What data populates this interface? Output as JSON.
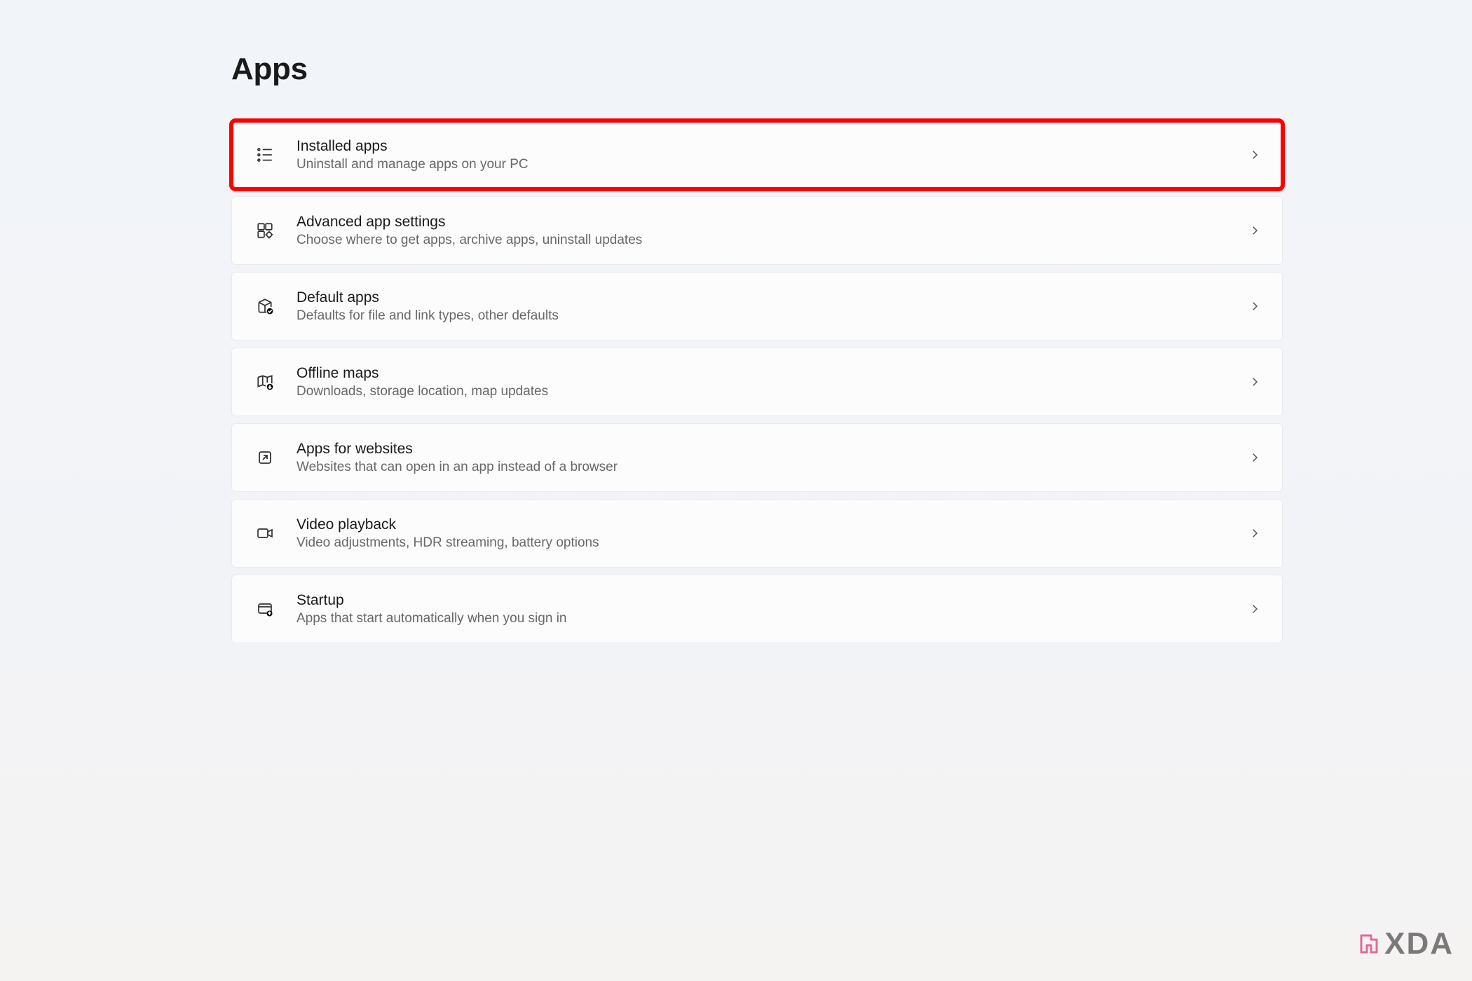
{
  "page": {
    "title": "Apps"
  },
  "items": [
    {
      "id": "installed-apps",
      "title": "Installed apps",
      "description": "Uninstall and manage apps on your PC",
      "icon": "list-checklist-icon",
      "highlighted": true
    },
    {
      "id": "advanced-app-settings",
      "title": "Advanced app settings",
      "description": "Choose where to get apps, archive apps, uninstall updates",
      "icon": "apps-gear-icon",
      "highlighted": false
    },
    {
      "id": "default-apps",
      "title": "Default apps",
      "description": "Defaults for file and link types, other defaults",
      "icon": "box-check-icon",
      "highlighted": false
    },
    {
      "id": "offline-maps",
      "title": "Offline maps",
      "description": "Downloads, storage location, map updates",
      "icon": "map-download-icon",
      "highlighted": false
    },
    {
      "id": "apps-for-websites",
      "title": "Apps for websites",
      "description": "Websites that can open in an app instead of a browser",
      "icon": "open-external-icon",
      "highlighted": false
    },
    {
      "id": "video-playback",
      "title": "Video playback",
      "description": "Video adjustments, HDR streaming, battery options",
      "icon": "video-icon",
      "highlighted": false
    },
    {
      "id": "startup",
      "title": "Startup",
      "description": "Apps that start automatically when you sign in",
      "icon": "startup-icon",
      "highlighted": false
    }
  ],
  "watermark": {
    "text": "XDA"
  }
}
